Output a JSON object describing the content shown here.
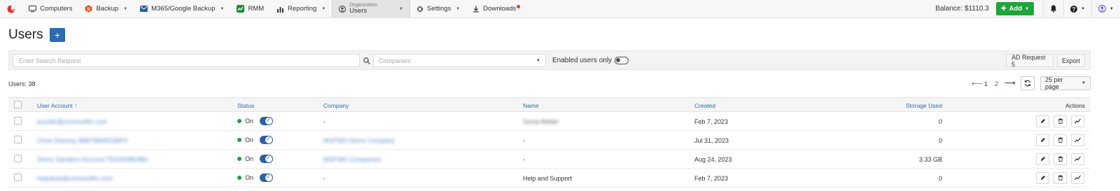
{
  "nav": {
    "items": [
      {
        "label": "Computers",
        "icon": "monitor-icon"
      },
      {
        "label": "Backup",
        "icon": "backup-icon"
      },
      {
        "label": "M365/Google Backup",
        "icon": "mail-icon"
      },
      {
        "label": "RMM",
        "icon": "rmm-icon"
      },
      {
        "label": "Reporting",
        "icon": "chart-icon"
      }
    ],
    "active": {
      "small": "Organization",
      "big": "Users"
    },
    "settings": "Settings",
    "downloads": "Downloads",
    "balance": "Balance: $1110.3",
    "add_label": "Add"
  },
  "page": {
    "title": "Users",
    "add_symbol": "+"
  },
  "filters": {
    "search_placeholder": "Enter Search Request",
    "companies_placeholder": "Companies",
    "enabled_only": "Enabled users only",
    "ad_request": "AD Request 5",
    "export": "Export"
  },
  "summary": {
    "users_count": "Users: 38",
    "pages": [
      "1",
      "2"
    ],
    "per_page": "25 per page"
  },
  "table": {
    "columns": {
      "user_account": "User Account",
      "status": "Status",
      "company": "Company",
      "name": "Name",
      "created": "Created",
      "storage": "Storage Used",
      "actions": "Actions"
    },
    "rows": [
      {
        "account": "purdatr@contosolfin.com",
        "status": "On",
        "company": "-",
        "company_blurred": false,
        "name": "Sonia Metter",
        "name_blurred": true,
        "created": "Feb 7, 2023",
        "storage": "0"
      },
      {
        "account": "Cima Ostrong 3BB79B9EE6BF0",
        "status": "On",
        "company": "MSP360 Demo Company",
        "company_blurred": true,
        "name": "-",
        "name_blurred": false,
        "created": "Jul 31, 2023",
        "storage": "0"
      },
      {
        "account": "Demo Sandbox Account TE0000BE9B0",
        "status": "On",
        "company": "MSP360 Companies",
        "company_blurred": true,
        "name": "-",
        "name_blurred": false,
        "created": "Aug 24, 2023",
        "storage": "3.33 GB"
      },
      {
        "account": "helpdesk@contosolfin.com",
        "status": "On",
        "company": "-",
        "company_blurred": false,
        "name": "Help and Support",
        "name_blurred": false,
        "created": "Feb 7, 2023",
        "storage": "0"
      }
    ]
  }
}
